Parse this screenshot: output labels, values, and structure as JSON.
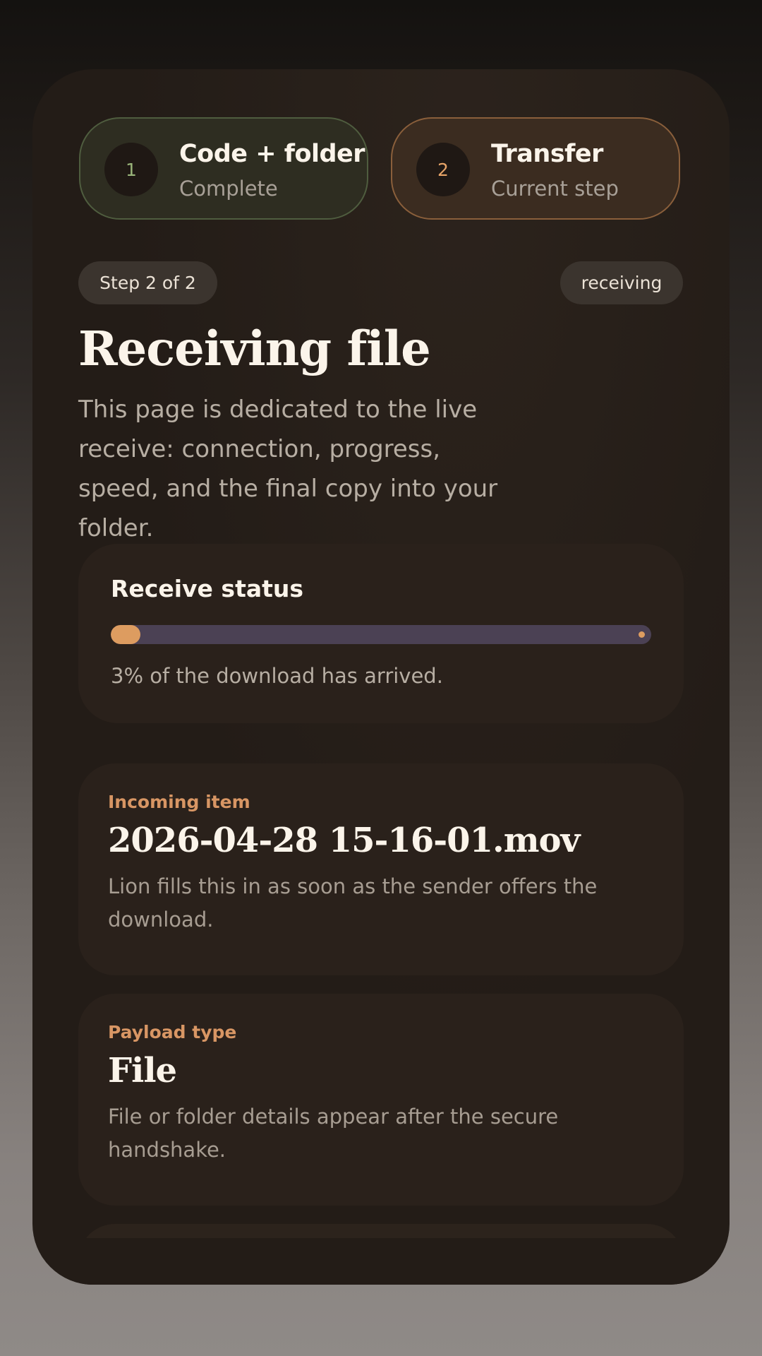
{
  "steps": [
    {
      "number": "1",
      "title": "Code + folder",
      "status": "Complete"
    },
    {
      "number": "2",
      "title": "Transfer",
      "status": "Current step"
    }
  ],
  "chips": {
    "step": "Step 2 of 2",
    "state": "receiving"
  },
  "header": {
    "title": "Receiving file",
    "description": "This page is dedicated to the live receive: connection, progress, speed, and the final copy into your folder."
  },
  "status": {
    "title": "Receive status",
    "progress_percent": 3,
    "caption": "3% of the download has arrived."
  },
  "incoming": {
    "label": "Incoming item",
    "value": "2026-04-28 15-16-01.mov",
    "description": "Lion fills this in as soon as the sender offers the download."
  },
  "payload": {
    "label": "Payload type",
    "value": "File",
    "description": "File or folder details appear after the secure handshake."
  },
  "colors": {
    "accent": "#dd9c60",
    "complete": "#9ab57a",
    "card": "#231c17"
  }
}
